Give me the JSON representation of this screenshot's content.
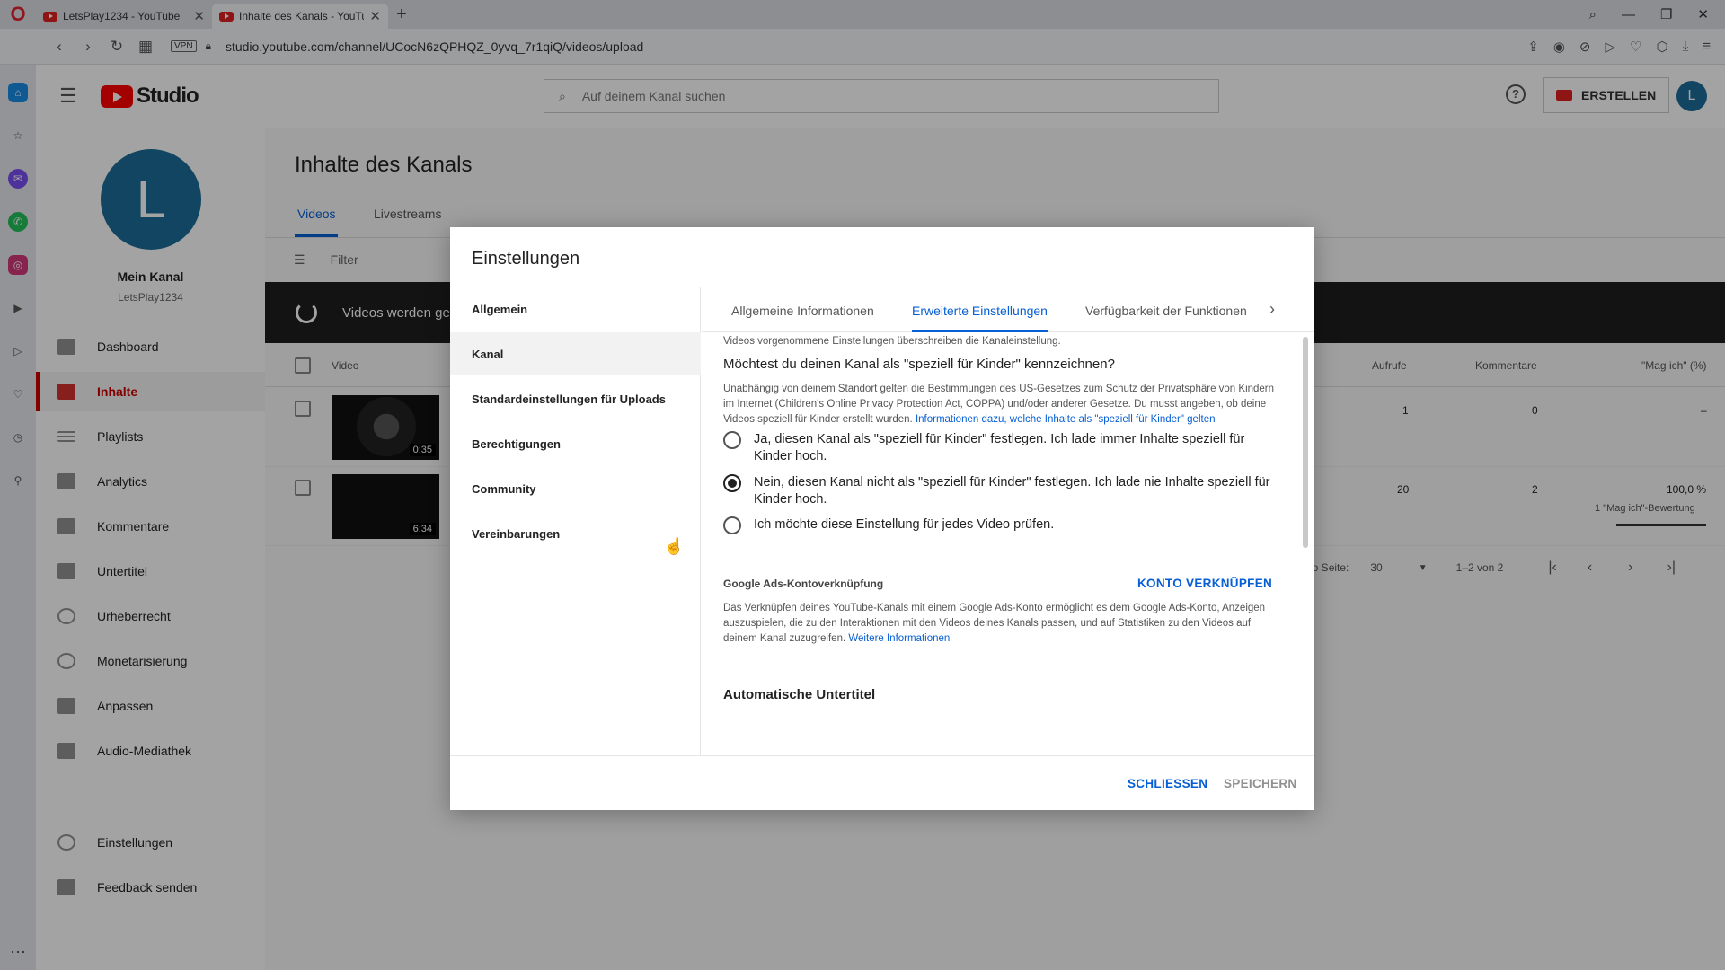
{
  "browser": {
    "tabs": [
      {
        "label": "LetsPlay1234 - YouTube"
      },
      {
        "label": "Inhalte des Kanals - YouTu"
      }
    ],
    "url": "studio.youtube.com/channel/UCocN6zQPHQZ_0yvq_7r1qiQ/videos/upload",
    "vpn_label": "VPN"
  },
  "header": {
    "logo_text": "Studio",
    "search_placeholder": "Auf deinem Kanal suchen",
    "help_label": "?",
    "create_label": "ERSTELLEN",
    "avatar_letter": "L"
  },
  "sidebar": {
    "avatar_letter": "L",
    "channel_label": "Mein Kanal",
    "channel_handle": "LetsPlay1234",
    "items": [
      {
        "label": "Dashboard"
      },
      {
        "label": "Inhalte"
      },
      {
        "label": "Playlists"
      },
      {
        "label": "Analytics"
      },
      {
        "label": "Kommentare"
      },
      {
        "label": "Untertitel"
      },
      {
        "label": "Urheberrecht"
      },
      {
        "label": "Monetarisierung"
      },
      {
        "label": "Anpassen"
      },
      {
        "label": "Audio-Mediathek"
      }
    ],
    "bottom_items": [
      {
        "label": "Einstellungen"
      },
      {
        "label": "Feedback senden"
      }
    ]
  },
  "main": {
    "title": "Inhalte des Kanals",
    "tabs": [
      {
        "label": "Videos"
      },
      {
        "label": "Livestreams"
      }
    ],
    "filter_placeholder": "Filter",
    "processing_text": "Videos werden ge",
    "table": {
      "headers": {
        "video": "Video",
        "views": "Aufrufe",
        "comments": "Kommentare",
        "likes": "\"Mag ich\" (%)"
      },
      "rows": [
        {
          "duration": "0:35",
          "views": "1",
          "comments": "0",
          "likes": "–",
          "likes_sub": ""
        },
        {
          "duration": "6:34",
          "views": "20",
          "comments": "2",
          "likes": "100,0 %",
          "likes_sub": "1 \"Mag ich\"-Bewertung"
        }
      ]
    },
    "pager": {
      "rows_label": "n pro Seite:",
      "rows_value": "30",
      "range": "1–2 von 2"
    }
  },
  "dialog": {
    "title": "Einstellungen",
    "nav": [
      {
        "label": "Allgemein"
      },
      {
        "label": "Kanal"
      },
      {
        "label": "Standardeinstellungen für Uploads"
      },
      {
        "label": "Berechtigungen"
      },
      {
        "label": "Community"
      },
      {
        "label": "Vereinbarungen"
      }
    ],
    "tabs": [
      {
        "label": "Allgemeine Informationen"
      },
      {
        "label": "Erweiterte Einstellungen"
      },
      {
        "label": "Verfügbarkeit der Funktionen"
      }
    ],
    "truncated_text": "Videos vorgenommene Einstellungen überschreiben die Kanaleinstellung.",
    "kids_question": "Möchtest du deinen Kanal als \"speziell für Kinder\" kennzeichnen?",
    "kids_desc": "Unabhängig von deinem Standort gelten die Bestimmungen des US-Gesetzes zum Schutz der Privatsphäre von Kindern im Internet (Children's Online Privacy Protection Act, COPPA) und/oder anderer Gesetze. Du musst angeben, ob deine Videos speziell für Kinder erstellt wurden.",
    "kids_link": "Informationen dazu, welche Inhalte als \"speziell für Kinder\" gelten",
    "options": [
      {
        "label": "Ja, diesen Kanal als \"speziell für Kinder\" festlegen. Ich lade immer Inhalte speziell für Kinder hoch.",
        "checked": false
      },
      {
        "label": "Nein, diesen Kanal nicht als \"speziell für Kinder\" festlegen. Ich lade nie Inhalte speziell für Kinder hoch.",
        "checked": true
      },
      {
        "label": "Ich möchte diese Einstellung für jedes Video prüfen.",
        "checked": false
      }
    ],
    "ads_title": "Google Ads-Kontoverknüpfung",
    "ads_link_button": "KONTO VERKNÜPFEN",
    "ads_desc": "Das Verknüpfen deines YouTube-Kanals mit einem Google Ads-Konto ermöglicht es dem Google Ads-Konto, Anzeigen auszuspielen, die zu den Interaktionen mit den Videos deines Kanals passen, und auf Statistiken zu den Videos auf deinem Kanal zuzugreifen.",
    "ads_more": "Weitere Informationen",
    "auto_subtitles": "Automatische Untertitel",
    "close_label": "SCHLIESSEN",
    "save_label": "SPEICHERN"
  },
  "colors": {
    "accent": "#065fd4",
    "brand": "#ff0000",
    "active_nav": "#cc0000"
  }
}
